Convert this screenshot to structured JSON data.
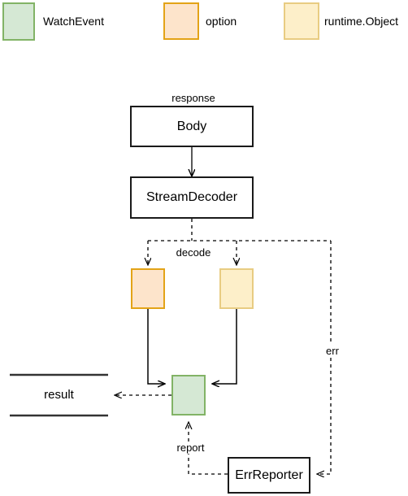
{
  "legend": {
    "items": [
      {
        "label": "WatchEvent",
        "fill": "#D5E8D4",
        "stroke": "#82B366",
        "swatch_name": "legend-swatch-watchevent"
      },
      {
        "label": "option",
        "fill": "#FDE4CB",
        "stroke": "#E3A317",
        "swatch_name": "legend-swatch-option"
      },
      {
        "label": "runtime.Object",
        "fill": "#FDEFC9",
        "stroke": "#E8CC82",
        "swatch_name": "legend-swatch-runtime-object"
      }
    ]
  },
  "nodes": {
    "body": {
      "label": "Body"
    },
    "stream_decoder": {
      "label": "StreamDecoder"
    },
    "option_box": {
      "label": ""
    },
    "runtime_object_box": {
      "label": ""
    },
    "watch_event_box": {
      "label": ""
    },
    "err_reporter": {
      "label": "ErrReporter"
    },
    "result": {
      "label": "result"
    }
  },
  "edges": {
    "response": {
      "label": "response"
    },
    "decode": {
      "label": "decode"
    },
    "err": {
      "label": "err"
    },
    "report": {
      "label": "report"
    }
  },
  "colors": {
    "outline": "#1a1a1a",
    "green_fill": "#D5E8D4",
    "green_stroke": "#82B366",
    "orange_fill": "#FDE4CB",
    "orange_stroke": "#E3A317",
    "yellow_fill": "#FDEFC9",
    "yellow_stroke": "#E8CC82",
    "background": "#FFFFFF"
  }
}
